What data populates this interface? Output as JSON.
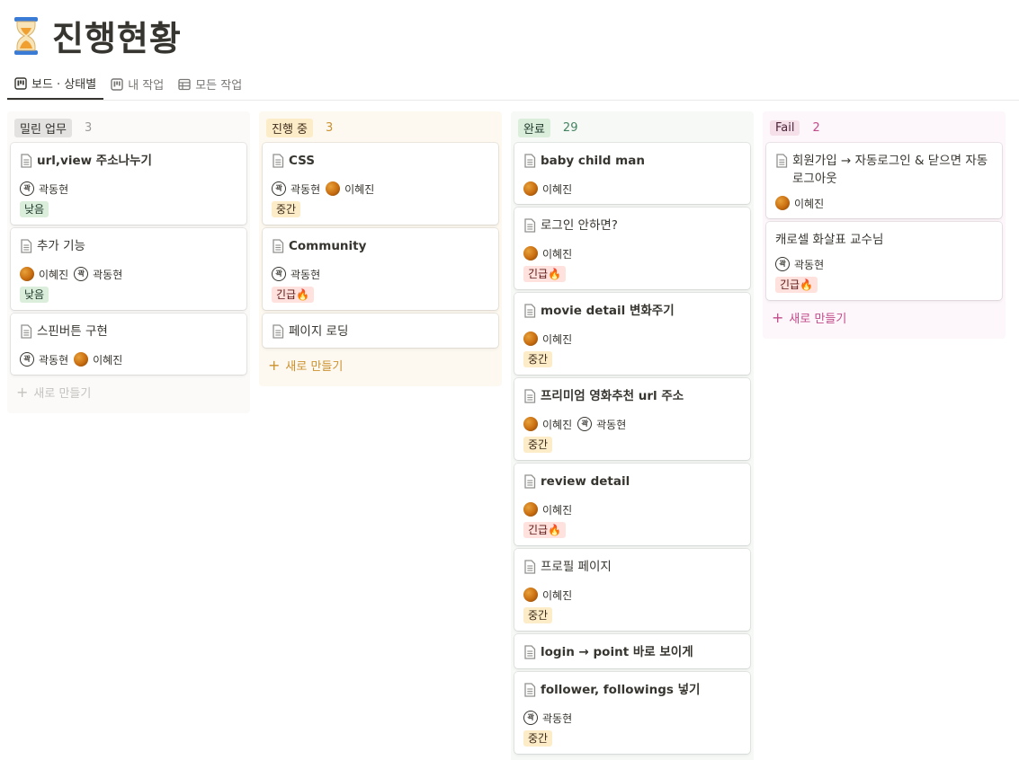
{
  "page": {
    "title": "진행현황",
    "icon": "hourglass-icon"
  },
  "tabs": [
    {
      "label": "보드 · 상태별",
      "icon": "board-icon",
      "active": true
    },
    {
      "label": "내 작업",
      "icon": "board-icon",
      "active": false
    },
    {
      "label": "모든 작업",
      "icon": "table-icon",
      "active": false
    }
  ],
  "colors": {
    "tag_low": "#dbeddb",
    "tag_mid": "#fdecc8",
    "tag_urgent": "#ffe2dd"
  },
  "columns": [
    {
      "label": "밀린 업무",
      "count": "3",
      "new_label": "새로 만들기",
      "cards": [
        {
          "title": "url,view 주소나누기",
          "people": [
            "곽동현"
          ],
          "tag": "낮음"
        },
        {
          "title": "추가 기능",
          "people": [
            "이혜진",
            "곽동현"
          ],
          "tag": "낮음"
        },
        {
          "title": "스핀버튼 구현",
          "people": [
            "곽동현",
            "이혜진"
          ],
          "tag": ""
        }
      ]
    },
    {
      "label": "진행 중",
      "count": "3",
      "new_label": "새로 만들기",
      "cards": [
        {
          "title": "CSS",
          "people": [
            "곽동현",
            "이혜진"
          ],
          "tag": "중간"
        },
        {
          "title": "Community",
          "people": [
            "곽동현"
          ],
          "tag": "긴급🔥"
        },
        {
          "title": "페이지 로딩",
          "people": [],
          "tag": ""
        }
      ]
    },
    {
      "label": "완료",
      "count": "29",
      "cards": [
        {
          "title": "baby child man",
          "people": [
            "이혜진"
          ],
          "tag": ""
        },
        {
          "title": "로그인 안하면?",
          "people": [
            "이혜진"
          ],
          "tag": "긴급🔥"
        },
        {
          "title": "movie detail 변화주기",
          "people": [
            "이혜진"
          ],
          "tag": "중간"
        },
        {
          "title": "프리미엄 영화추천 url 주소",
          "people": [
            "이혜진",
            "곽동현"
          ],
          "tag": "중간"
        },
        {
          "title": "review detail",
          "people": [
            "이혜진"
          ],
          "tag": "긴급🔥"
        },
        {
          "title": "프로필 페이지",
          "people": [
            "이혜진"
          ],
          "tag": "중간"
        },
        {
          "title": "login → point 바로 보이게",
          "people": [],
          "tag": ""
        },
        {
          "title": "follower, followings 넣기",
          "people": [
            "곽동현"
          ],
          "tag": "중간"
        }
      ]
    },
    {
      "label": "Fail",
      "count": "2",
      "new_label": "새로 만들기",
      "cards": [
        {
          "title": "회원가입 → 자동로그인 & 닫으면 자동 로그아웃",
          "people": [
            "이혜진"
          ],
          "tag": "",
          "icon": true
        },
        {
          "title": "캐로셀 화살표 교수님",
          "people": [
            "곽동현"
          ],
          "tag": "긴급🔥",
          "icon": false
        }
      ]
    }
  ]
}
